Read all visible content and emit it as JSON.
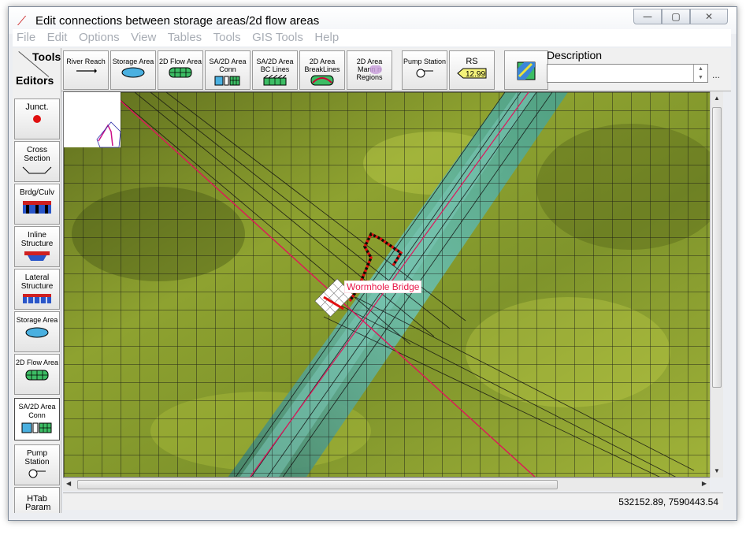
{
  "window": {
    "title": "Edit connections between storage areas/2d flow areas",
    "min_glyph": "—",
    "max_glyph": "▢",
    "close_glyph": "✕"
  },
  "menu": [
    "File",
    "Edit",
    "Options",
    "View",
    "Tables",
    "Tools",
    "GIS Tools",
    "Help"
  ],
  "tools_header": {
    "tools": "Tools",
    "editors": "Editors"
  },
  "toolbar": [
    {
      "name": "river-reach",
      "label": "River Reach",
      "icon": "arrow-right-icon"
    },
    {
      "name": "storage-area",
      "label": "Storage Area",
      "icon": "storage-area-icon"
    },
    {
      "name": "2d-flow-area",
      "label": "2D Flow Area",
      "icon": "flow-area-grid-icon"
    },
    {
      "name": "sa-2d-conn",
      "label": "SA/2D Area Conn",
      "icon": "sa-conn-icon"
    },
    {
      "name": "2d-bc-lines",
      "label": "SA/2D Area BC Lines",
      "icon": "bc-lines-icon"
    },
    {
      "name": "2d-breaklines",
      "label": "2D Area BreakLines",
      "icon": "breaklines-icon"
    },
    {
      "name": "2d-mannings",
      "label": "2D Area Mann n Regions",
      "icon": "mannings-region-icon"
    },
    {
      "name": "pump-station",
      "label": "Pump Station",
      "icon": "pump-icon"
    },
    {
      "name": "rs",
      "label": "RS",
      "icon": "rs-tag-icon",
      "tag": "12.99"
    },
    {
      "name": "map-layers",
      "label": "",
      "icon": "map-layers-icon"
    }
  ],
  "description": {
    "label": "Description",
    "value": "",
    "more": "..."
  },
  "editors": [
    {
      "name": "junction",
      "label": "Junct.",
      "icon": "junction-dot-icon",
      "active": false
    },
    {
      "name": "cross-section",
      "label": "Cross Section",
      "icon": "cross-section-icon",
      "active": false
    },
    {
      "name": "bridge-culvert",
      "label": "Brdg/Culv",
      "icon": "bridge-icon",
      "active": false
    },
    {
      "name": "inline-structure",
      "label": "Inline Structure",
      "icon": "inline-structure-icon",
      "active": false
    },
    {
      "name": "lateral-structure",
      "label": "Lateral Structure",
      "icon": "lateral-structure-icon",
      "active": false
    },
    {
      "name": "storage-area",
      "label": "Storage Area",
      "icon": "storage-area-icon",
      "active": false
    },
    {
      "name": "2d-flow-area",
      "label": "2D Flow Area",
      "icon": "flow-area-grid-icon",
      "active": false
    },
    {
      "name": "sa-2d-conn",
      "label": "SA/2D Area Conn",
      "icon": "sa-conn-icon",
      "active": true
    },
    {
      "name": "pump-station",
      "label": "Pump Station",
      "icon": "pump-icon",
      "active": false
    },
    {
      "name": "htab-param",
      "label": "HTab Param",
      "icon": "",
      "active": false
    }
  ],
  "map": {
    "connection_label": "Wormhole Bridge",
    "colors": {
      "terrain": "#7a8f2c",
      "channel": "#5fb0a0",
      "grid": "#1a1a1a",
      "river": "#e0145a",
      "connection": "#e01010"
    }
  },
  "status": {
    "coordinates": "532152.89, 7590443.54"
  }
}
